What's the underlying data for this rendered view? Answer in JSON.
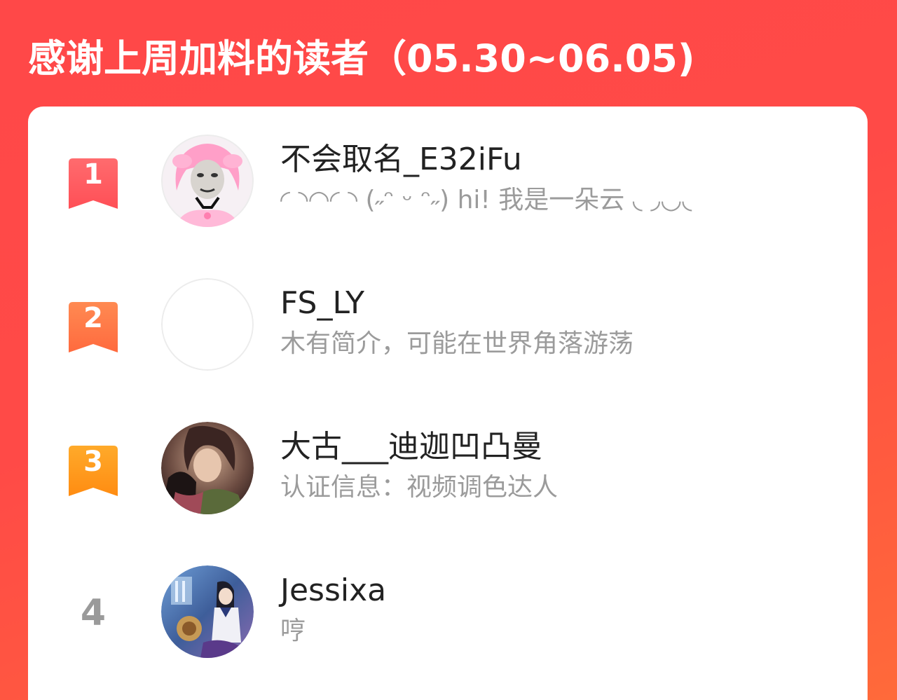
{
  "header": {
    "title": "感谢上周加料的读者（05.30~06.05)"
  },
  "colors": {
    "background_top": "#ff4848",
    "background_bottom": "#ff6a3a",
    "rank1": "#ff5a5e",
    "rank2": "#ff7a48",
    "rank3": "#ff9a1e",
    "rank_plain": "#9a9a9a"
  },
  "readers": [
    {
      "rank": "1",
      "name": "不会取名_E32iFu",
      "bio": "◜ ◝◠◜ ◝ (˶ᵔ ᵕ ᵔ˶) hi! 我是一朵云 ◟ ◞◡◟"
    },
    {
      "rank": "2",
      "name": "FS_LY",
      "bio": "木有简介，可能在世界角落游荡"
    },
    {
      "rank": "3",
      "name": "大古___迪迦凹凸曼",
      "bio": "认证信息：视频调色达人"
    },
    {
      "rank": "4",
      "name": "Jessixa",
      "bio": "哼"
    }
  ]
}
